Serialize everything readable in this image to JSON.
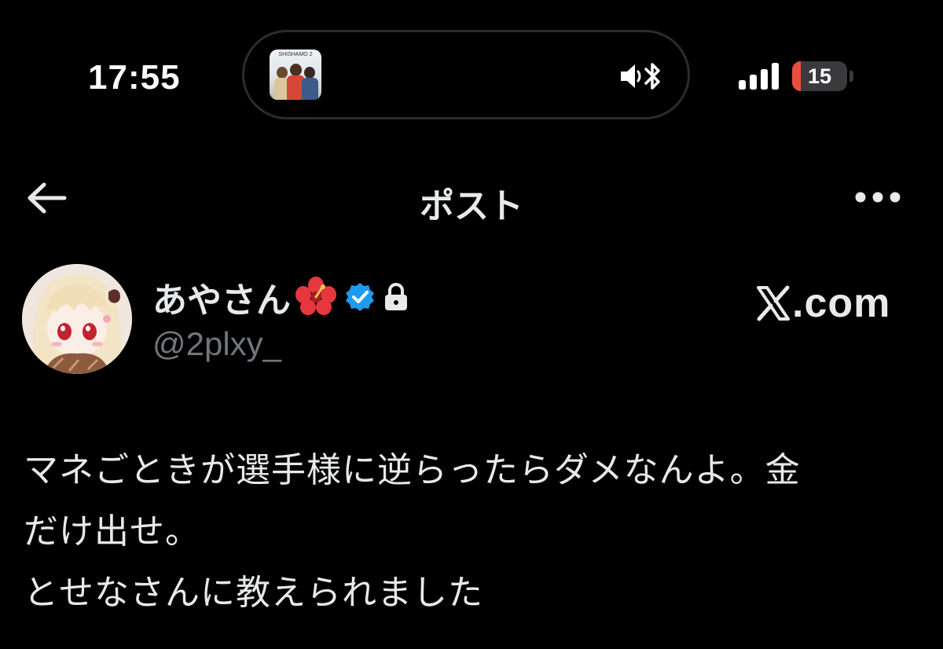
{
  "status_bar": {
    "time": "17:55",
    "battery_level": "15",
    "battery_fraction": 0.15,
    "now_playing": {
      "album_art_title": "SHISHAMO 2",
      "icons": [
        "speaker-icon",
        "bluetooth-icon"
      ]
    },
    "signal_icon": "cellular-signal-icon"
  },
  "header": {
    "title": "ポスト",
    "back_icon": "back-arrow-icon",
    "more_icon": "more-icon"
  },
  "post": {
    "author": {
      "display_name": "あやさん",
      "emoji_icon": "hibiscus-icon",
      "verified_icon": "verified-badge-icon",
      "protected_icon": "lock-icon",
      "handle": "@2plxy_"
    },
    "watermark": {
      "logo_icon": "x-logo-icon",
      "text": ".com"
    },
    "body_lines": [
      "マネごときが選手様に逆らったらダメなんよ。金",
      "だけ出せ。",
      "とせなさんに教えられました"
    ]
  },
  "colors": {
    "background": "#000000",
    "text_primary": "#e7e9ea",
    "text_secondary": "#71767b",
    "verified_blue": "#1d9bf0",
    "battery_low": "#eb4e3d"
  }
}
